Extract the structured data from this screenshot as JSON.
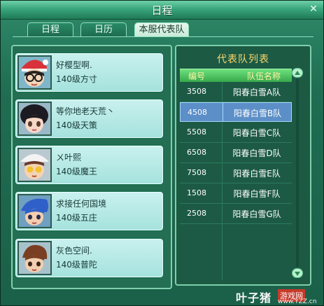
{
  "window": {
    "title": "日程"
  },
  "tabs": [
    {
      "label": "日程",
      "active": false
    },
    {
      "label": "日历",
      "active": false
    },
    {
      "label": "本服代表队",
      "active": true
    }
  ],
  "members": [
    {
      "name": "好樱型啊.",
      "desc": "140级方寸",
      "avatar": "boy-glasses-santa-hat"
    },
    {
      "name": "等你地老天荒丶",
      "desc": "140级天策",
      "avatar": "girl-black-hair"
    },
    {
      "name": "ㄨ叶熙",
      "desc": "140级魔王",
      "avatar": "boy-white-hat-golden-eyes"
    },
    {
      "name": "求接任何国境",
      "desc": "140级五庄",
      "avatar": "boy-blue-hair"
    },
    {
      "name": "灰色空间.",
      "desc": "140级普陀",
      "avatar": "boy-brown-hair"
    }
  ],
  "team_list": {
    "title": "代表队列表",
    "columns": [
      "编号",
      "队伍名称"
    ],
    "rows": [
      {
        "id": "3508",
        "name": "阳春白雪A队",
        "selected": false
      },
      {
        "id": "4508",
        "name": "阳春白雪B队",
        "selected": true
      },
      {
        "id": "5508",
        "name": "阳春白雪C队",
        "selected": false
      },
      {
        "id": "6508",
        "name": "阳春白雪D队",
        "selected": false
      },
      {
        "id": "7508",
        "name": "阳春白雪E队",
        "selected": false
      },
      {
        "id": "1508",
        "name": "阳春白雪F队",
        "selected": false
      },
      {
        "id": "2508",
        "name": "阳春白雪G队",
        "selected": false
      }
    ]
  },
  "watermark": {
    "brand": "叶子猪",
    "tag": "游戏网",
    "url": "www.YZZ.cn"
  },
  "colors": {
    "title_gold": "#ffd86a",
    "selected_row": "#5c8fc7",
    "header_green": "#36a94b"
  }
}
